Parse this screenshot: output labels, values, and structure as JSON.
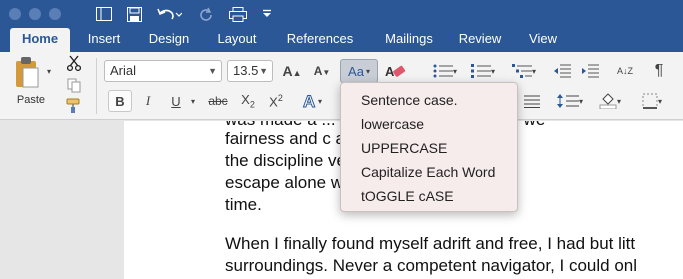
{
  "quick_access": {
    "sidebar_icon": "sidebar-icon",
    "save_icon": "save-icon",
    "undo_icon": "undo-icon",
    "redo_icon": "redo-icon",
    "print_icon": "print-icon",
    "customize_icon": "customize-icon"
  },
  "tabs": [
    "Home",
    "Insert",
    "Design",
    "Layout",
    "References",
    "Mailings",
    "Review",
    "View"
  ],
  "ribbon": {
    "paste_label": "Paste",
    "font_name": "Arial",
    "font_size": "13.5",
    "bold": "B",
    "italic": "I",
    "underline": "U",
    "strikethrough": "abc",
    "subscript_base": "X",
    "subscript_mark": "2",
    "superscript_base": "X",
    "superscript_mark": "2",
    "change_case": "Aa",
    "sort_glyph": "A↓Z",
    "paragraph_mark": "¶"
  },
  "case_menu": {
    "items": [
      "Sentence case.",
      "lowercase",
      "UPPERCASE",
      "Capitalize Each Word",
      "tOGGLE cASE"
    ]
  },
  "document": {
    "lines": [
      "was made a ... ... ... ... ... ... of her crew we",
      "fairness and c                  as naval prisoners. S",
      "the discipline                  ve days after we wer",
      "escape alone                    water and provisions",
      "time.",
      "When I finally found myself adrift and free, I had but litt",
      "surroundings. Never a competent navigator, I could onl"
    ]
  },
  "colors": {
    "title_bar": "#2b5797",
    "ribbon": "#f3f3f3",
    "menu_bg": "#f6ecec",
    "active_tab_text": "#2b5797"
  }
}
